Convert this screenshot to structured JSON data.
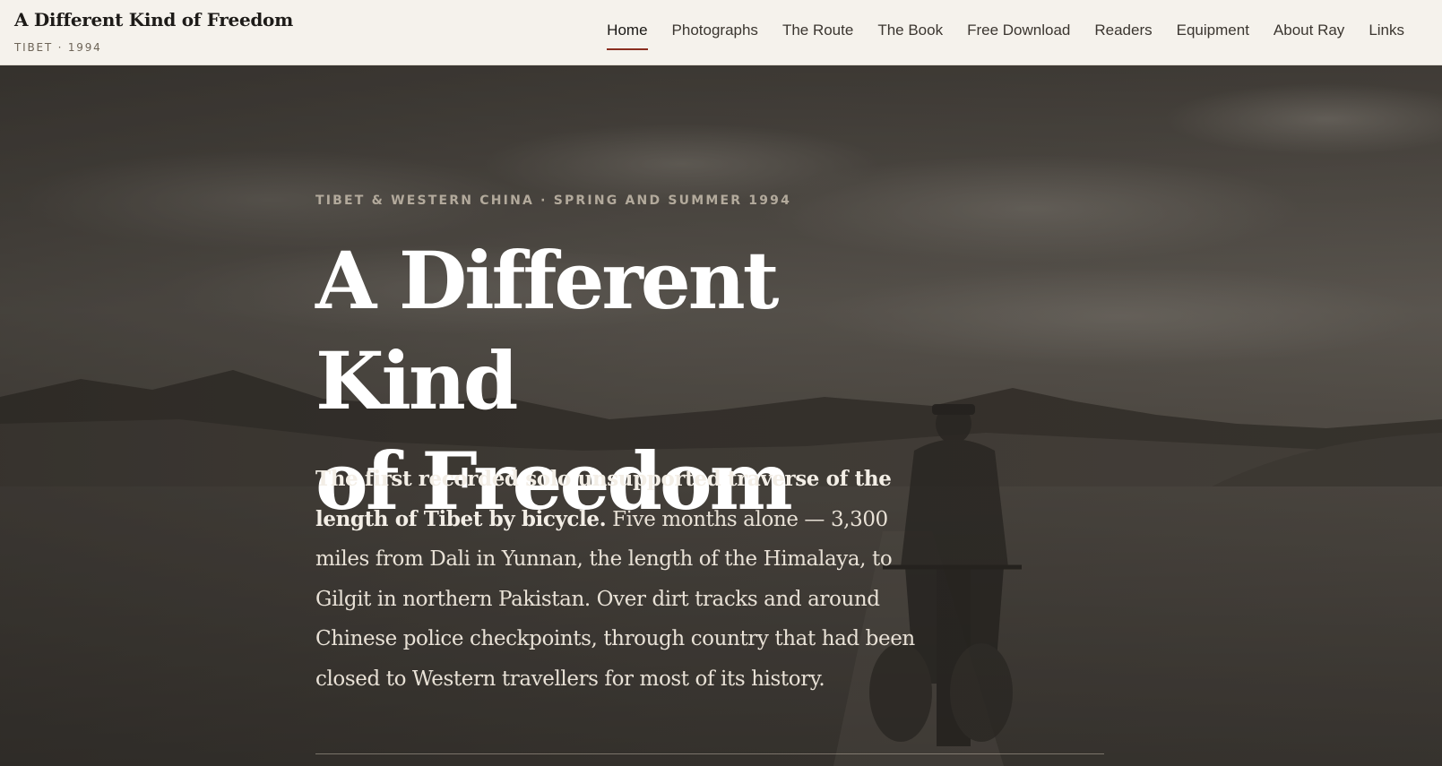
{
  "site": {
    "title": "A Different Kind of Freedom",
    "subtitle": "TIBET · 1994"
  },
  "nav": {
    "items": [
      {
        "label": "Home",
        "active": true
      },
      {
        "label": "Photographs"
      },
      {
        "label": "The Route"
      },
      {
        "label": "The Book"
      },
      {
        "label": "Free Download"
      },
      {
        "label": "Readers"
      },
      {
        "label": "Equipment"
      },
      {
        "label": "About Ray"
      },
      {
        "label": "Links"
      }
    ],
    "active_color": "#8a2e20"
  },
  "hero": {
    "eyebrow": "TIBET & WESTERN CHINA · SPRING AND SUMMER 1994",
    "title_line1": "A Different Kind",
    "title_line2": "of Freedom",
    "lead_bold": "The first recorded solo unsupported traverse of the length of Tibet by bicycle.",
    "lead_rest": " Five months alone — 3,300 miles from Dali in Yunnan, the length of the Himalaya, to Gilgit in northern Pakistan. Over dirt tracks and around Chinese police checkpoints, through country that had been closed to Western travellers for most of its history.",
    "background_image": "sepia photograph of a cyclist on a dirt road across a mountain plateau under a clouded sky"
  },
  "colors": {
    "header_bg": "#f5f2ec",
    "hero_overlay": "#2e2a26",
    "title_text": "#ffffff",
    "body_text": "#e8e1d6",
    "eyebrow_text": "#b3aa9c"
  }
}
